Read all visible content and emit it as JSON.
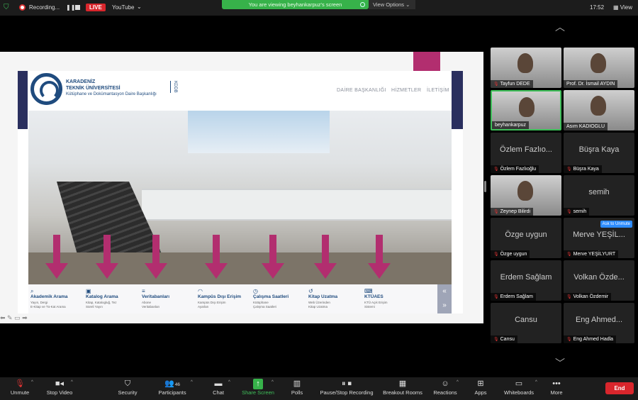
{
  "top_bar": {
    "recording_label": "Recording...",
    "live_label": "LIVE",
    "stream_target": "YouTube",
    "viewing_banner": "You are viewing beyhankarpuz's screen",
    "view_options": "View Options",
    "time": "17:52",
    "view_label": "View"
  },
  "shared_site": {
    "university_line1": "KARADENİZ",
    "university_line2": "TEKNİK ÜNİVERSİTESİ",
    "university_sub": "Kütüphane ve Dokümantasyon Daire Başkanlığı",
    "kddb": "KDDB",
    "nav": [
      "DAİRE BAŞKANLIĞI",
      "HİZMETLER",
      "İLETİŞİM"
    ],
    "menu": [
      {
        "icon": "search-icon",
        "glyph": "⌕",
        "title": "Akademik Arama",
        "sub1": "Yayın, Dergi",
        "sub2": "E-Kitap ve Tü-Kat Arama"
      },
      {
        "icon": "book-icon",
        "glyph": "▣",
        "title": "Katalog Arama",
        "sub1": "Kitap, Katalogluğ, Tez",
        "sub2": "Süreli Yayın"
      },
      {
        "icon": "database-icon",
        "glyph": "≡",
        "title": "Veritabanları",
        "sub1": "Abone",
        "sub2": "Veritabanları"
      },
      {
        "icon": "rss-icon",
        "glyph": "◠",
        "title": "Kampüs Dışı Erişim",
        "sub1": "Kampüs Dışı Erişim",
        "sub2": "Ayarları"
      },
      {
        "icon": "clock-icon",
        "glyph": "◷",
        "title": "Çalışma Saatleri",
        "sub1": "Kütüphane",
        "sub2": "Çalışma Saatleri"
      },
      {
        "icon": "history-icon",
        "glyph": "↺",
        "title": "Kitap Uzatma",
        "sub1": "Web Üzerinden",
        "sub2": "Kitap Uzatma"
      },
      {
        "icon": "keyboard-icon",
        "glyph": "⌨",
        "title": "KTÜAES",
        "sub1": "KTÜ Açık Erişim",
        "sub2": "Sistemi"
      }
    ]
  },
  "participants": [
    {
      "name": "Tayfun DEDE",
      "video": true
    },
    {
      "name": "Prof. Dr. İsmail AYDIN",
      "video": true
    },
    {
      "name": "beyhankarpuz",
      "video": true,
      "active": true
    },
    {
      "name": "Asım KADIOGLU",
      "video": true
    },
    {
      "name": "Özlem Fazlıoğlu",
      "big": "Özlem Fazlıo...",
      "video": false
    },
    {
      "name": "Büşra Kaya",
      "big": "Büşra Kaya",
      "video": false
    },
    {
      "name": "Zeynep Bilirdi",
      "video": true
    },
    {
      "name": "semih",
      "big": "semih",
      "video": false
    },
    {
      "name": "Özge uygun",
      "big": "Özge uygun",
      "video": false
    },
    {
      "name": "Merve YEŞİLYURT",
      "big": "Merve YEŞİL...",
      "video": false,
      "badge": "Ask to Unmute"
    },
    {
      "name": "Erdem Sağlam",
      "big": "Erdem Sağlam",
      "video": false
    },
    {
      "name": "Volkan Özdemir",
      "big": "Volkan Özde...",
      "video": false
    },
    {
      "name": "Cansu",
      "big": "Cansu",
      "video": false
    },
    {
      "name": "Eng Ahmed Hadla",
      "big": "Eng Ahmed...",
      "video": false
    }
  ],
  "toolbar": {
    "unmute": "Unmute",
    "stop_video": "Stop Video",
    "security": "Security",
    "participants": "Participants",
    "participants_count": "46",
    "chat": "Chat",
    "share_screen": "Share Screen",
    "polls": "Polls",
    "recording": "Pause/Stop Recording",
    "breakout": "Breakout Rooms",
    "reactions": "Reactions",
    "apps": "Apps",
    "whiteboards": "Whiteboards",
    "more": "More",
    "end": "End"
  },
  "colors": {
    "accent_pink": "#b22e6f",
    "ktu_blue": "#1f4b7e",
    "zoom_green": "#37b24a",
    "end_red": "#d9262c"
  }
}
